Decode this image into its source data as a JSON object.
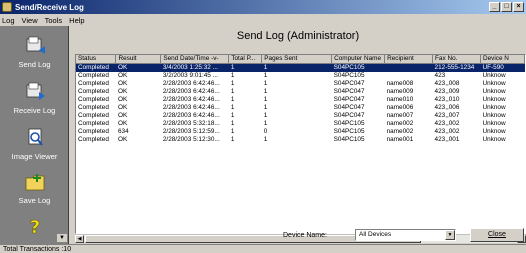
{
  "window": {
    "title": "Send/Receive Log",
    "buttons": {
      "minimize": "_",
      "maximize": "□",
      "close": "×"
    }
  },
  "menu": {
    "items": [
      "Log",
      "View",
      "Tools",
      "Help"
    ]
  },
  "sidebar": {
    "items": [
      {
        "label": "Send Log",
        "icon": "send-log-icon"
      },
      {
        "label": "Receive Log",
        "icon": "receive-log-icon"
      },
      {
        "label": "Image Viewer",
        "icon": "image-viewer-icon"
      },
      {
        "label": "Save Log",
        "icon": "save-log-icon"
      },
      {
        "label": "",
        "icon": "help-icon"
      }
    ],
    "scroll_arrow": "▼"
  },
  "main": {
    "title": "Send Log (Administrator)"
  },
  "table": {
    "columns": [
      "Status",
      "Result",
      "Send Date/Time -v-",
      "Total P...",
      "Pages Sent",
      "Computer Name",
      "Recipient",
      "Fax No.",
      "Device N"
    ],
    "rows": [
      [
        "Completed",
        "OK",
        "3/4/2003 1:25:32 ...",
        "1",
        "1",
        "S04PC105",
        "",
        "212-555-1234",
        "UF-590"
      ],
      [
        "Completed",
        "OK",
        "3/2/2003 9:01:45 ...",
        "1",
        "1",
        "S04PC105",
        "",
        "423",
        "Unknow"
      ],
      [
        "Completed",
        "OK",
        "2/28/2003 6:42:46...",
        "1",
        "1",
        "S04PC047",
        "name008",
        "423,,008",
        "Unknow"
      ],
      [
        "Completed",
        "OK",
        "2/28/2003 6:42:46...",
        "1",
        "1",
        "S04PC047",
        "name009",
        "423,,009",
        "Unknow"
      ],
      [
        "Completed",
        "OK",
        "2/28/2003 6:42:46...",
        "1",
        "1",
        "S04PC047",
        "name010",
        "423,,010",
        "Unknow"
      ],
      [
        "Completed",
        "OK",
        "2/28/2003 6:42:46...",
        "1",
        "1",
        "S04PC047",
        "name006",
        "423,,006",
        "Unknow"
      ],
      [
        "Completed",
        "OK",
        "2/28/2003 6:42:46...",
        "1",
        "1",
        "S04PC047",
        "name007",
        "423,,007",
        "Unknow"
      ],
      [
        "Completed",
        "OK",
        "2/28/2003 5:32:18...",
        "1",
        "1",
        "S04PC105",
        "name002",
        "423,,002",
        "Unknow"
      ],
      [
        "Completed",
        "634",
        "2/28/2003 5:12:59...",
        "1",
        "0",
        "S04PC105",
        "name002",
        "423,,002",
        "Unknow"
      ],
      [
        "Completed",
        "OK",
        "2/28/2003 5:12:30...",
        "1",
        "1",
        "S04PC105",
        "name001",
        "423,,001",
        "Unknow"
      ]
    ],
    "selected_row": 0
  },
  "footer": {
    "device_label": "Device Name:",
    "device_value": "All Devices",
    "close_label": "Close"
  },
  "status": {
    "text": "Total Transactions :10"
  },
  "colors": {
    "titlebar_start": "#0a246a",
    "selection": "#0a246a",
    "sidebar": "#808080",
    "face": "#d4d0c8"
  }
}
